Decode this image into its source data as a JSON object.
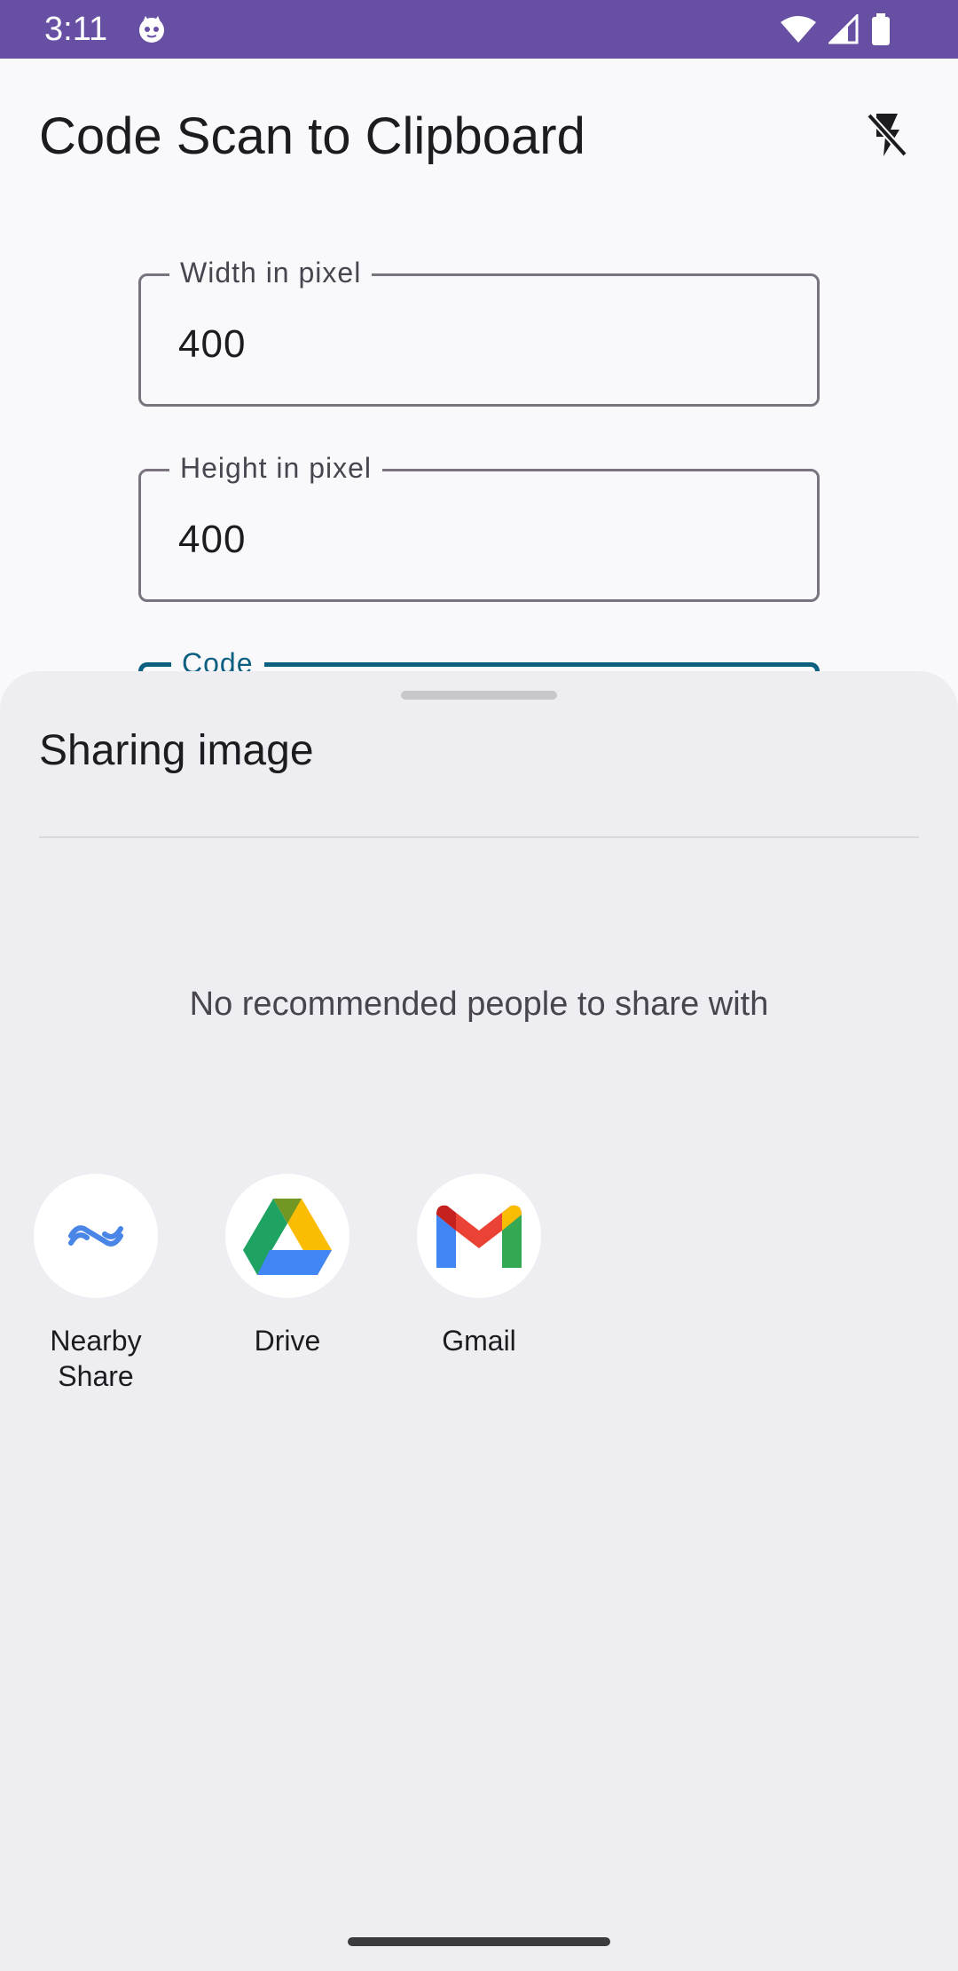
{
  "status_bar": {
    "time": "3:11"
  },
  "app_bar": {
    "title": "Code Scan to Clipboard",
    "flash_icon": "flash-off-icon"
  },
  "form": {
    "width_label": "Width in pixel",
    "width_value": "400",
    "height_label": "Height in pixel",
    "height_value": "400",
    "code_label": "Code"
  },
  "share_sheet": {
    "title": "Sharing image",
    "empty_message": "No recommended people to share with",
    "apps": [
      {
        "label": "Nearby\nShare",
        "icon": "nearby-share-icon"
      },
      {
        "label": "Drive",
        "icon": "google-drive-icon"
      },
      {
        "label": "Gmail",
        "icon": "gmail-icon"
      }
    ]
  },
  "colors": {
    "status_bar": "#6750a4",
    "focused_field": "#0b5f80",
    "sheet_background": "#eeedf2"
  }
}
